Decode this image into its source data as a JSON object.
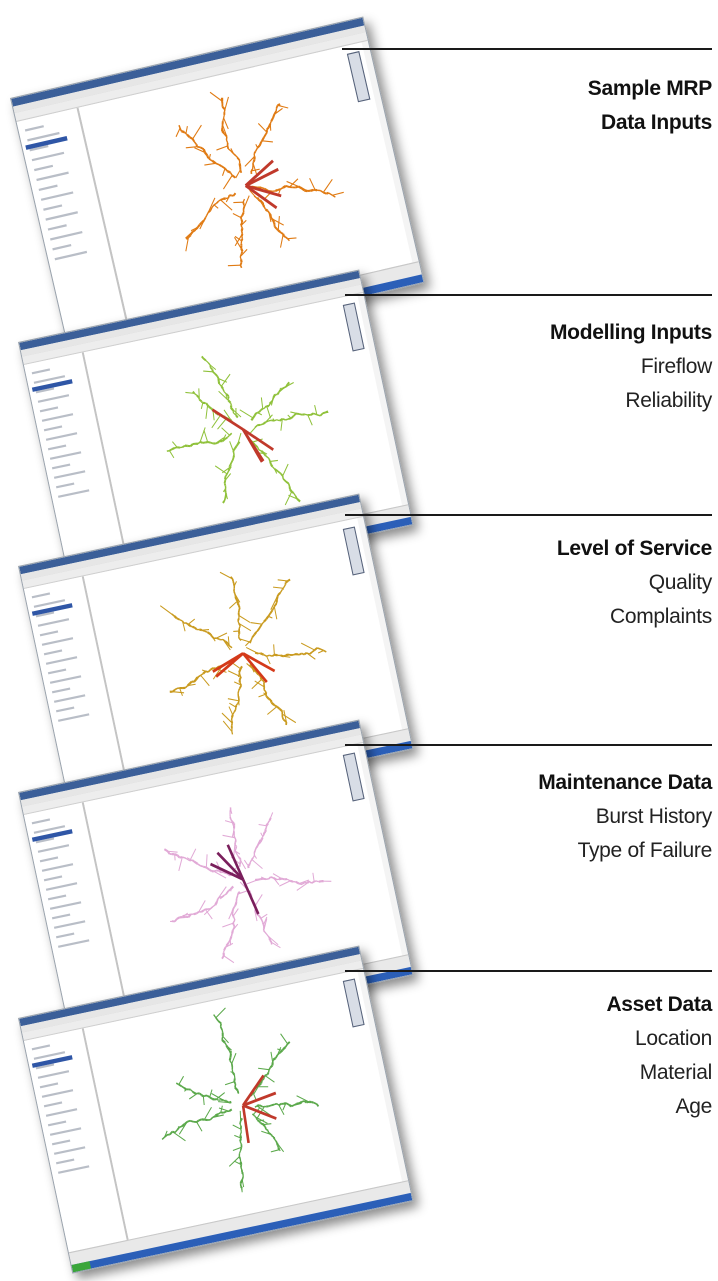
{
  "sections": [
    {
      "heading": "Sample MRP",
      "lines": [
        "Data Inputs"
      ],
      "line_style": "bold",
      "map_color": "#e07a12",
      "accent_color": "#c0392b"
    },
    {
      "heading": "Modelling Inputs",
      "lines": [
        "Fireflow",
        "Reliability"
      ],
      "line_style": "regular",
      "map_color": "#8fc13a",
      "accent_color": "#c0392b"
    },
    {
      "heading": "Level of Service",
      "lines": [
        "Quality",
        "Complaints"
      ],
      "line_style": "regular",
      "map_color": "#c99a1e",
      "accent_color": "#d43a1a"
    },
    {
      "heading": "Maintenance Data",
      "lines": [
        "Burst History",
        "Type of Failure"
      ],
      "line_style": "regular",
      "map_color": "#e1a9d6",
      "accent_color": "#7a1f5c"
    },
    {
      "heading": "Asset Data",
      "lines": [
        "Location",
        "Material",
        "Age"
      ],
      "line_style": "regular",
      "map_color": "#5aa84a",
      "accent_color": "#c0392b"
    }
  ],
  "window_colors": {
    "titlebar": "#3b5f99",
    "taskbar": "#2b5fb8",
    "selection": "#2f56a6"
  }
}
